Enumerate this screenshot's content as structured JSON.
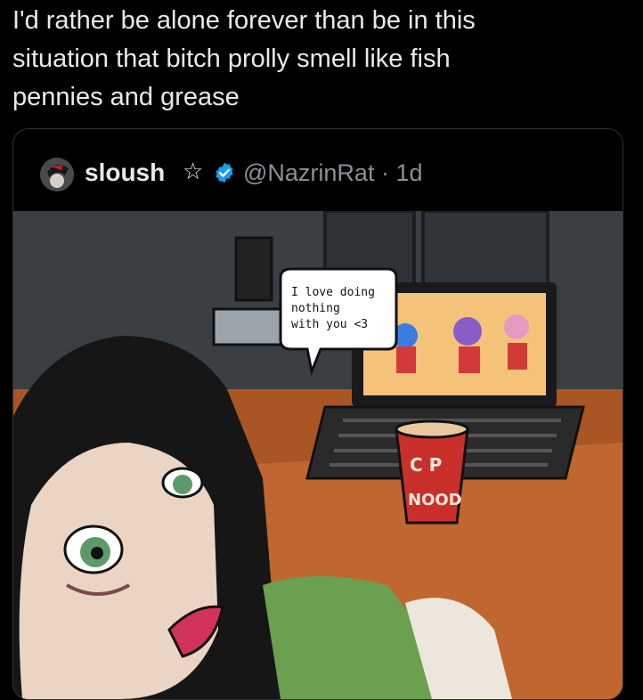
{
  "tweet": {
    "text": "I'd rather be alone forever than be in this\nsituation that bitch prolly smell like fish\npennies and grease"
  },
  "quote": {
    "display_name": "sloush",
    "star_glyph": "☆",
    "handle": "@NazrinRat",
    "separator": "·",
    "time": "1d",
    "image": {
      "speech_bubble": [
        "I love doing",
        "nothing",
        "with you <3"
      ],
      "cup_label_top": "C P",
      "cup_label_bottom": "NOOD"
    }
  },
  "colors": {
    "background": "#000000",
    "text": "#e7e9ea",
    "muted": "#8b9196",
    "card_border": "#2f3336",
    "verified": "#1d9bf0"
  },
  "icons": [
    "avatar",
    "star-icon",
    "verified-badge-icon"
  ]
}
